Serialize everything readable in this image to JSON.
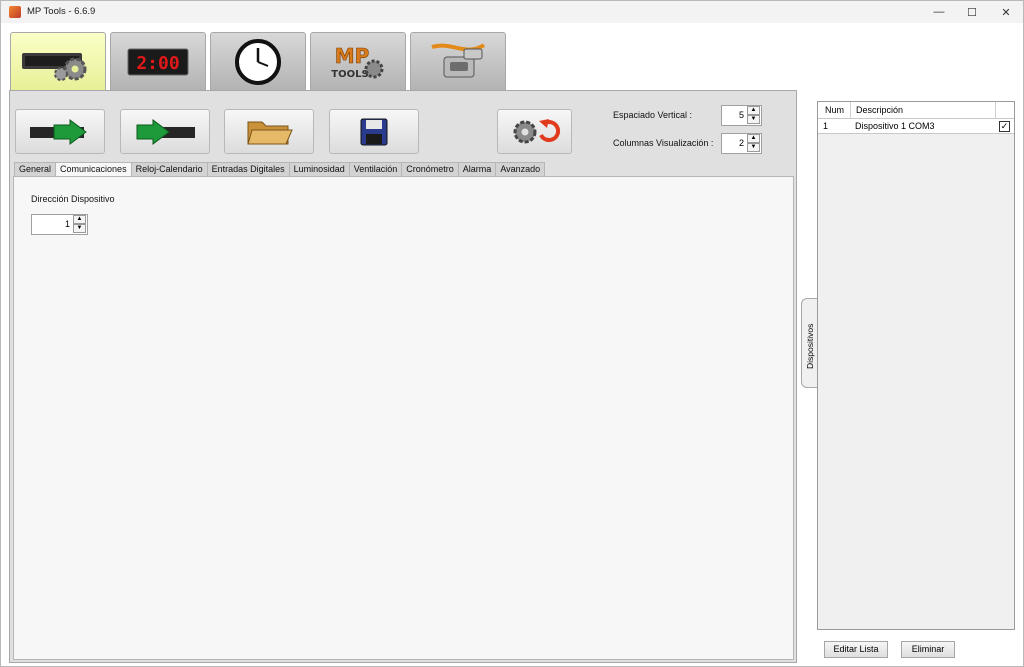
{
  "window": {
    "title": "MP Tools - 6.6.9",
    "minimize": "—",
    "maximize": "☐",
    "close": "✕"
  },
  "top_tabs": [
    {
      "icon": "display-settings-icon",
      "active": true
    },
    {
      "icon": "led-clock-display-icon",
      "active": false
    },
    {
      "icon": "wall-clock-icon",
      "active": false
    },
    {
      "icon": "mp-tools-logo-icon",
      "active": false
    },
    {
      "icon": "serial-cable-icon",
      "active": false
    }
  ],
  "toolbar": {
    "read_icon": "read-from-device-icon",
    "send_icon": "send-to-device-icon",
    "open_icon": "folder-open-icon",
    "save_icon": "floppy-save-icon",
    "reset_icon": "reset-settings-icon"
  },
  "settings": {
    "vertical_spacing_label": "Espaciado Vertical :",
    "vertical_spacing_value": "5",
    "columns_label": "Columnas Visualización :",
    "columns_value": "2"
  },
  "sub_tabs": [
    "General",
    "Comunicaciones",
    "Reloj-Calendario",
    "Entradas Digitales",
    "Luminosidad",
    "Ventilación",
    "Cronómetro",
    "Alarma",
    "Avanzado"
  ],
  "active_sub_tab": "Comunicaciones",
  "communications": {
    "address_label": "Dirección Dispositivo",
    "address_value": "1"
  },
  "devices_panel": {
    "handle_label": "Dispositivos",
    "columns": {
      "num": "Num",
      "description": "Descripción"
    },
    "rows": [
      {
        "num": "1",
        "description": "Dispositivo 1 COM3",
        "checked": true
      }
    ],
    "edit_button": "Editar Lista",
    "delete_button": "Eliminar"
  }
}
